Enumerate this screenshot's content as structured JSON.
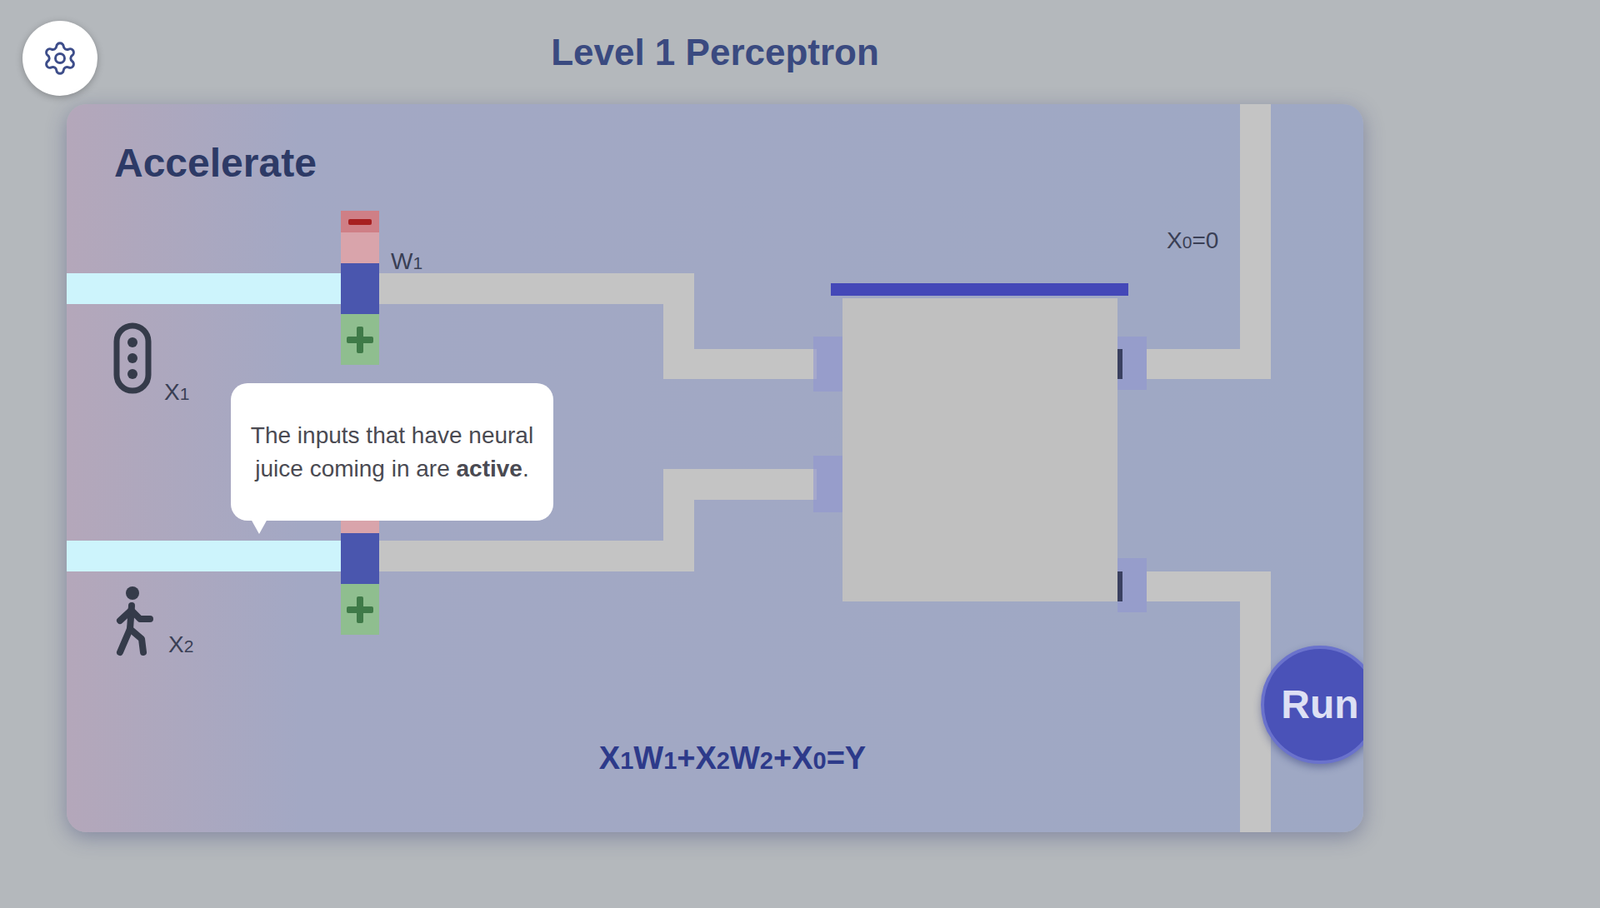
{
  "title": "Level 1 Perceptron",
  "level_name": "Accelerate",
  "inputs": [
    {
      "label": {
        "base": "X",
        "sub": "1"
      },
      "active": true,
      "icon": "traffic-light",
      "weight_label": {
        "base": "W",
        "sub": "1"
      }
    },
    {
      "label": {
        "base": "X",
        "sub": "2"
      },
      "active": true,
      "icon": "pedestrian",
      "weight_label": null
    }
  ],
  "bias_label": {
    "base": "X",
    "sub": "0",
    "rest": "=0"
  },
  "tooltip": [
    {
      "text": "The inputs that have neural juice coming in are ",
      "bold": false
    },
    {
      "text": "active",
      "bold": true
    },
    {
      "text": ".",
      "bold": false
    }
  ],
  "equation": [
    {
      "text": "X",
      "sub": false
    },
    {
      "text": "1",
      "sub": true
    },
    {
      "text": "W",
      "sub": false
    },
    {
      "text": "1",
      "sub": true
    },
    {
      "text": "+X",
      "sub": false
    },
    {
      "text": "2",
      "sub": true
    },
    {
      "text": "W",
      "sub": false
    },
    {
      "text": "2",
      "sub": true
    },
    {
      "text": "+X",
      "sub": false
    },
    {
      "text": "0",
      "sub": true
    },
    {
      "text": "=Y",
      "sub": false
    }
  ],
  "buttons": [
    "Run"
  ]
}
